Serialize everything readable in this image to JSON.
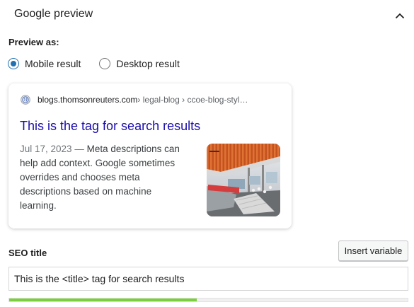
{
  "panel": {
    "title": "Google preview"
  },
  "preview_as": {
    "label": "Preview as:",
    "options": [
      {
        "label": "Mobile result",
        "selected": true
      },
      {
        "label": "Desktop result",
        "selected": false
      }
    ]
  },
  "serp": {
    "url": "blogs.thomsonreuters.com",
    "path": " › legal-blog › ccoe-blog-styl…",
    "title": "This is the tag for search results",
    "date": "Jul 17, 2023",
    "separator": " — ",
    "description": "Meta descriptions can help add context. Google sometimes overrides and chooses meta descriptions based on machine learning."
  },
  "seo_title": {
    "label": "SEO title",
    "insert_button": "Insert variable",
    "value": "This is the <title> tag for search results",
    "progress": 0.47,
    "progress_color": "#7ad03a"
  },
  "colors": {
    "accent": "#2271b1",
    "link": "#1a0dab"
  },
  "icons": {
    "collapse": "chevron-up-icon",
    "favicon": "globe-icon"
  }
}
